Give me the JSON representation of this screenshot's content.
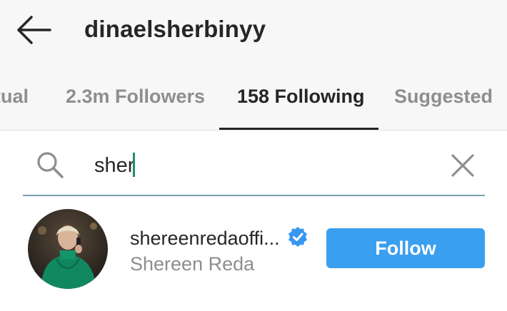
{
  "header": {
    "title": "dinaelsherbinyy",
    "back_icon": "arrow-left-icon"
  },
  "tabs": [
    {
      "label": "tual",
      "active": false
    },
    {
      "label": "2.3m Followers",
      "active": false
    },
    {
      "label": "158 Following",
      "active": true
    },
    {
      "label": "Suggested",
      "active": false
    }
  ],
  "search": {
    "value": "sher",
    "icon": "search-icon",
    "clear_icon": "close-icon"
  },
  "results": [
    {
      "username": "shereenredaoffi...",
      "full_name": "Shereen Reda",
      "verified": true,
      "action_label": "Follow"
    }
  ],
  "colors": {
    "accent": "#3b9ff0",
    "header_bg": "#f7f7f7",
    "muted_text": "#8e8e8e",
    "verified_badge": "#3897f0",
    "caret": "#1e8e6b"
  }
}
